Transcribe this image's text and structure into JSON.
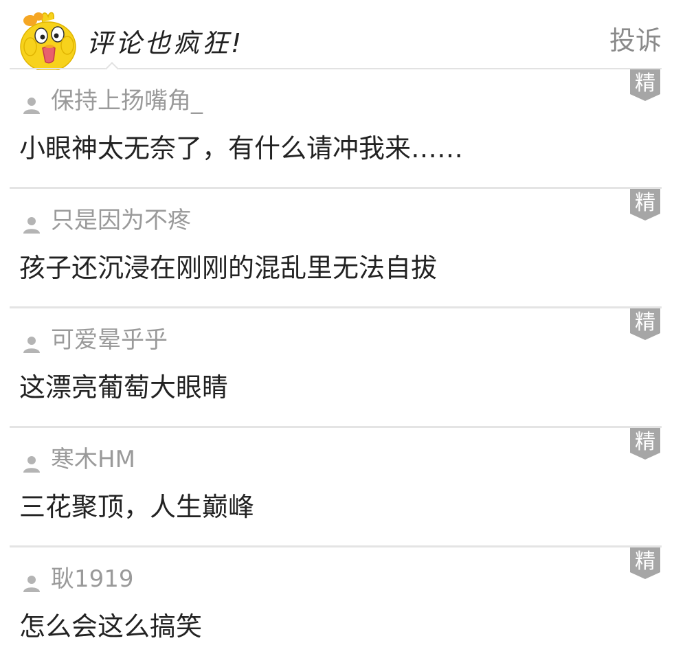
{
  "header": {
    "title": "评论也疯狂!",
    "report_label": "投诉"
  },
  "comments": [
    {
      "user": "保持上扬嘴角_",
      "text": "小眼神太无奈了，有什么请冲我来……",
      "badge": "精"
    },
    {
      "user": "只是因为不疼",
      "text": "孩子还沉浸在刚刚的混乱里无法自拔",
      "badge": "精"
    },
    {
      "user": "可爱晕乎乎",
      "text": "这漂亮葡萄大眼睛",
      "badge": "精"
    },
    {
      "user": "寒木HM",
      "text": "三花聚顶，人生巅峰",
      "badge": "精"
    },
    {
      "user": "耿1919",
      "text": "怎么会这么搞笑",
      "badge": "精"
    }
  ],
  "colors": {
    "badge_bg": "#a6a6a6",
    "username": "#9a9a9a",
    "text": "#222222",
    "divider": "#e4e4e4",
    "mascot_yellow": "#f7d21c"
  },
  "icons": {
    "mascot": "yellow-chick-mascot-icon",
    "user": "user-silhouette-icon"
  }
}
